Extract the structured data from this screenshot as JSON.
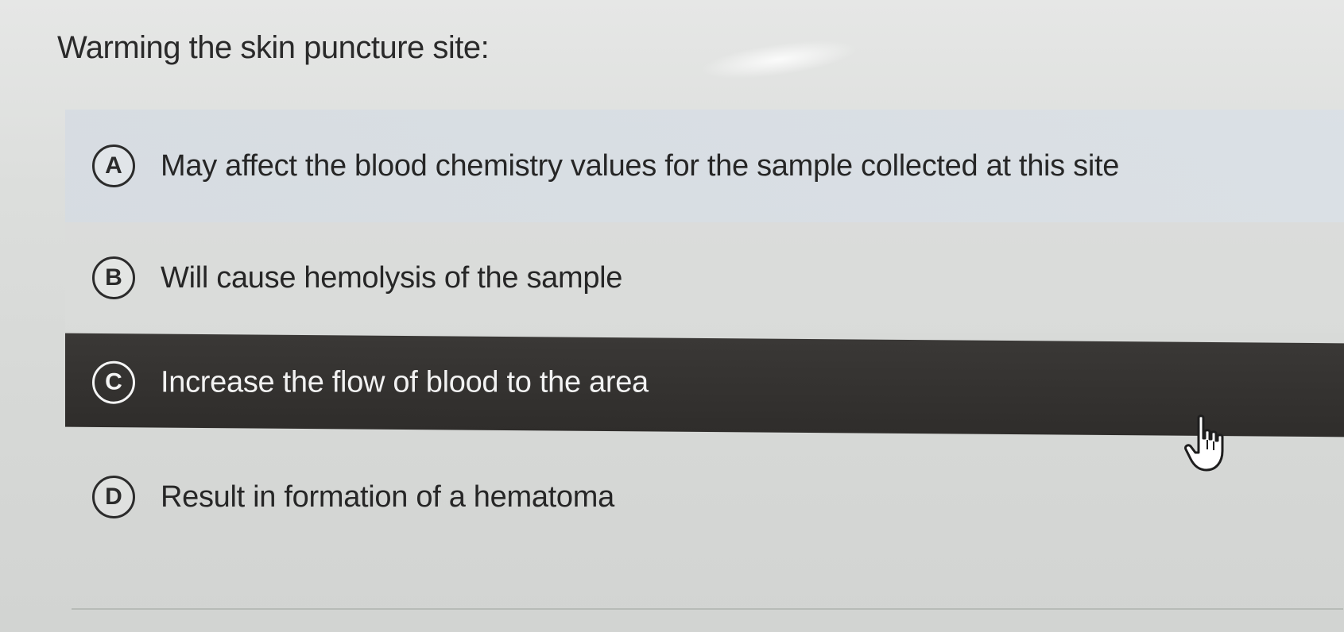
{
  "question": {
    "text": "Warming the skin puncture site:"
  },
  "options": [
    {
      "letter": "A",
      "text": "May affect the blood chemistry values for the sample collected at this site",
      "selected": false
    },
    {
      "letter": "B",
      "text": "Will cause hemolysis of the sample",
      "selected": false
    },
    {
      "letter": "C",
      "text": "Increase the flow of blood to the area",
      "selected": true
    },
    {
      "letter": "D",
      "text": "Result in formation of a hematoma",
      "selected": false
    }
  ],
  "colors": {
    "selected_background": "#33312f",
    "selected_text": "#f2f2f2",
    "text": "#262626",
    "background": "#dcdedc"
  },
  "icons": {
    "cursor": "hand-pointer-icon"
  }
}
